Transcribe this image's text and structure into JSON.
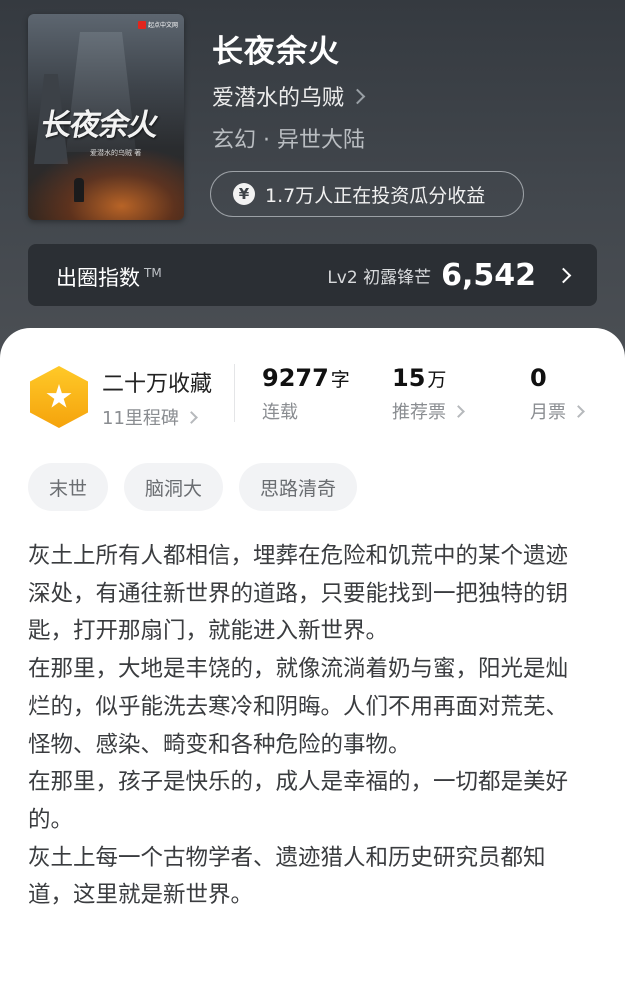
{
  "book": {
    "cover_title": "长夜余火",
    "cover_author": "爱潜水的乌贼 著",
    "cover_publisher": "起点中文网",
    "title": "长夜余火",
    "author": "爱潜水的乌贼",
    "genre": "玄幻 · 异世大陆",
    "invest_text": "1.7万人正在投资瓜分收益",
    "invest_icon": "yen-coin-icon"
  },
  "influence": {
    "label": "出圈指数",
    "tm": "TM",
    "level": "Lv2 初露锋芒",
    "value": "6,542"
  },
  "stats": {
    "collection_title": "二十万收藏",
    "milestone": "11里程碑",
    "words": "9277",
    "words_unit": "字",
    "status": "连载",
    "recommend": "15",
    "recommend_unit": "万",
    "recommend_label": "推荐票",
    "monthly": "0",
    "monthly_label": "月票"
  },
  "tags": [
    "末世",
    "脑洞大",
    "思路清奇"
  ],
  "synopsis": [
    "灰土上所有人都相信，埋葬在危险和饥荒中的某个遗迹深处，有通往新世界的道路，只要能找到一把独特的钥匙，打开那扇门，就能进入新世界。",
    "在那里，大地是丰饶的，就像流淌着奶与蜜，阳光是灿烂的，似乎能洗去寒冷和阴晦。人们不用再面对荒芜、怪物、感染、畸变和各种危险的事物。",
    "在那里，孩子是快乐的，成人是幸福的，一切都是美好的。",
    "灰土上每一个古物学者、遗迹猎人和历史研究员都知道，这里就是新世界。"
  ],
  "colors": {
    "header_bg": "#3a3f45",
    "badge_gold": "#f5a30c",
    "card_bg": "#ffffff"
  }
}
